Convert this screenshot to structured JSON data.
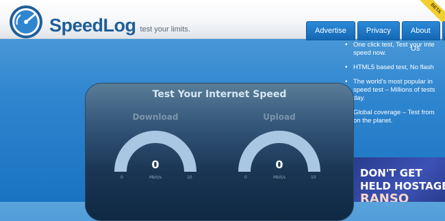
{
  "header": {
    "brand": "SpeedLog",
    "tagline": "test your limits.",
    "beta": "BETA"
  },
  "nav": [
    {
      "label": "Advertise"
    },
    {
      "label": "Privacy"
    },
    {
      "label": "About Us"
    }
  ],
  "features": [
    "One click test, Test your inte speed now.",
    "HTML5 based test, No flash",
    "The world's most popular in speed test – Millions of tests day.",
    "Global coverage – Test from on the planet."
  ],
  "feature_lines": [
    [
      "One click test, Test your inte",
      "speed now."
    ],
    [
      "HTML5 based test, No flash"
    ],
    [
      "The world's most popular in",
      "speed test – Millions of tests",
      "day."
    ],
    [
      "Global coverage – Test from",
      "on the planet."
    ]
  ],
  "panel": {
    "title": "Test Your Internet Speed",
    "download": {
      "label": "Download",
      "value": "0",
      "unit": "Mbit/s",
      "min": "0",
      "max": "10"
    },
    "upload": {
      "label": "Upload",
      "value": "0",
      "unit": "Mbit/s",
      "min": "0",
      "max": "10"
    }
  },
  "ad": {
    "line1": "DON'T GET",
    "line2": "HELD HOSTAGE",
    "line3": "RANSO"
  },
  "colors": {
    "accent": "#1f5e9a",
    "gauge": "#a9c6e3"
  }
}
